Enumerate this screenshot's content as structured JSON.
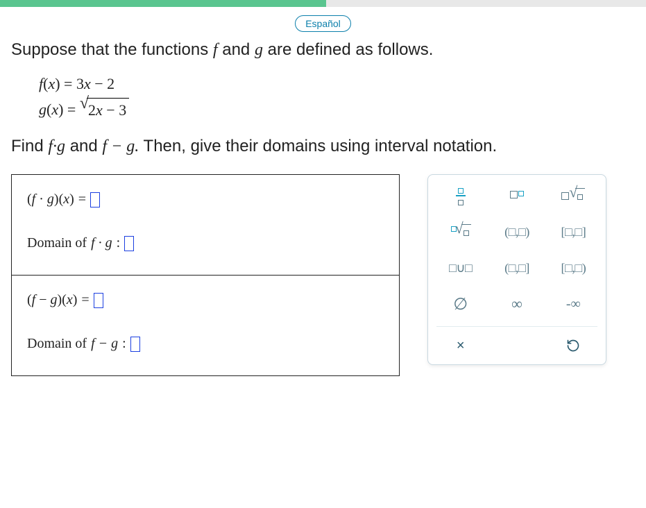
{
  "lang_button": "Español",
  "intro": {
    "pre": "Suppose that the functions ",
    "f": "f",
    "mid": " and ",
    "g": "g",
    "post": " are defined as follows."
  },
  "defs": {
    "f_lhs_f": "f",
    "f_lhs_x": "x",
    "f_eq": "=",
    "f_rhs": "3x − 2",
    "g_lhs_g": "g",
    "g_lhs_x": "x",
    "g_eq": "=",
    "g_rhs": "2x − 3"
  },
  "find": {
    "pre": "Find ",
    "fg": "f·g",
    "mid": " and ",
    "fminusg": "f − g.",
    "post": " Then, give their domains using interval notation."
  },
  "answers": {
    "fg_expr": "(f · g)(x) = ",
    "fg_domain_label": "Domain of ",
    "fg_domain_func": "f · g",
    "fminusg_expr": "(f − g)(x) = ",
    "fminusg_domain_label": "Domain of ",
    "fminusg_domain_func": "f − g",
    "colon": " : "
  },
  "keypad": {
    "open_paren": "(□,□)",
    "closed_bracket": "[□,□]",
    "union": "□∪□",
    "half_open_right": "(□,□]",
    "half_open_left": "[□,□)",
    "empty_set": "∅",
    "infinity": "∞",
    "neg_infinity": "-∞",
    "clear": "×",
    "undo_label": "undo"
  }
}
